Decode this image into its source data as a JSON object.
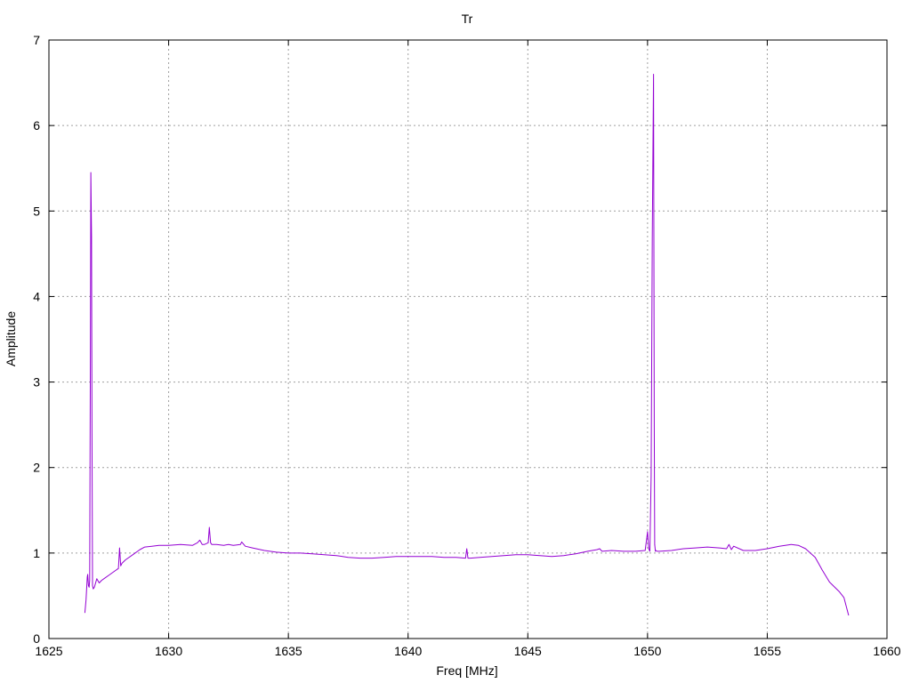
{
  "chart_data": {
    "type": "line",
    "title": "Tr",
    "xlabel": "Freq [MHz]",
    "ylabel": "Amplitude",
    "xlim": [
      1625,
      1660
    ],
    "ylim": [
      0,
      7
    ],
    "x_ticks": [
      1625,
      1630,
      1635,
      1640,
      1645,
      1650,
      1655,
      1660
    ],
    "y_ticks": [
      0,
      1,
      2,
      3,
      4,
      5,
      6,
      7
    ],
    "grid": true,
    "legend": "none",
    "series": [
      {
        "color": "#9400d3",
        "x": [
          1626.5,
          1626.55,
          1626.6,
          1626.62,
          1626.65,
          1626.68,
          1626.7,
          1626.73,
          1626.75,
          1626.78,
          1626.8,
          1626.82,
          1626.85,
          1626.9,
          1627.0,
          1627.1,
          1627.2,
          1627.3,
          1627.5,
          1627.7,
          1627.9,
          1627.95,
          1628.0,
          1628.05,
          1628.2,
          1628.5,
          1628.8,
          1629.0,
          1629.3,
          1629.6,
          1630.0,
          1630.5,
          1631.0,
          1631.2,
          1631.3,
          1631.4,
          1631.5,
          1631.65,
          1631.7,
          1631.75,
          1631.8,
          1632.0,
          1632.3,
          1632.5,
          1632.7,
          1633.0,
          1633.05,
          1633.2,
          1633.5,
          1634.0,
          1634.5,
          1635.0,
          1635.5,
          1636.0,
          1636.5,
          1637.0,
          1637.5,
          1638.0,
          1638.5,
          1639.0,
          1639.5,
          1640.0,
          1640.5,
          1641.0,
          1641.5,
          1642.0,
          1642.4,
          1642.45,
          1642.5,
          1642.6,
          1643.0,
          1643.5,
          1644.0,
          1644.5,
          1645.0,
          1645.5,
          1646.0,
          1646.5,
          1647.0,
          1647.5,
          1647.9,
          1648.0,
          1648.1,
          1648.5,
          1649.0,
          1649.5,
          1649.9,
          1650.0,
          1650.05,
          1650.1,
          1650.15,
          1650.2,
          1650.25,
          1650.28,
          1650.3,
          1650.33,
          1650.35,
          1650.4,
          1650.5,
          1651.0,
          1651.5,
          1652.0,
          1652.5,
          1653.0,
          1653.3,
          1653.4,
          1653.5,
          1653.6,
          1654.0,
          1654.5,
          1655.0,
          1655.5,
          1656.0,
          1656.3,
          1656.6,
          1657.0,
          1657.3,
          1657.6,
          1658.0,
          1658.2,
          1658.4
        ],
        "y": [
          0.3,
          0.45,
          0.72,
          0.75,
          0.62,
          0.6,
          0.68,
          3.3,
          5.45,
          4.7,
          2.4,
          0.62,
          0.58,
          0.6,
          0.7,
          0.65,
          0.68,
          0.7,
          0.74,
          0.78,
          0.82,
          1.06,
          0.85,
          0.88,
          0.92,
          0.98,
          1.04,
          1.07,
          1.08,
          1.09,
          1.09,
          1.1,
          1.09,
          1.12,
          1.15,
          1.1,
          1.1,
          1.12,
          1.3,
          1.12,
          1.1,
          1.1,
          1.09,
          1.1,
          1.09,
          1.1,
          1.13,
          1.08,
          1.06,
          1.03,
          1.01,
          1.0,
          1.0,
          0.99,
          0.98,
          0.97,
          0.95,
          0.94,
          0.94,
          0.95,
          0.96,
          0.96,
          0.96,
          0.96,
          0.95,
          0.95,
          0.94,
          1.05,
          0.94,
          0.94,
          0.95,
          0.96,
          0.97,
          0.98,
          0.98,
          0.97,
          0.96,
          0.97,
          0.99,
          1.02,
          1.04,
          1.05,
          1.02,
          1.03,
          1.02,
          1.02,
          1.03,
          1.25,
          1.05,
          1.02,
          1.9,
          4.7,
          6.6,
          2.5,
          1.1,
          1.02,
          1.03,
          1.02,
          1.02,
          1.03,
          1.05,
          1.06,
          1.07,
          1.06,
          1.05,
          1.1,
          1.04,
          1.08,
          1.03,
          1.03,
          1.05,
          1.08,
          1.1,
          1.09,
          1.05,
          0.95,
          0.8,
          0.66,
          0.55,
          0.48,
          0.27
        ]
      }
    ]
  }
}
